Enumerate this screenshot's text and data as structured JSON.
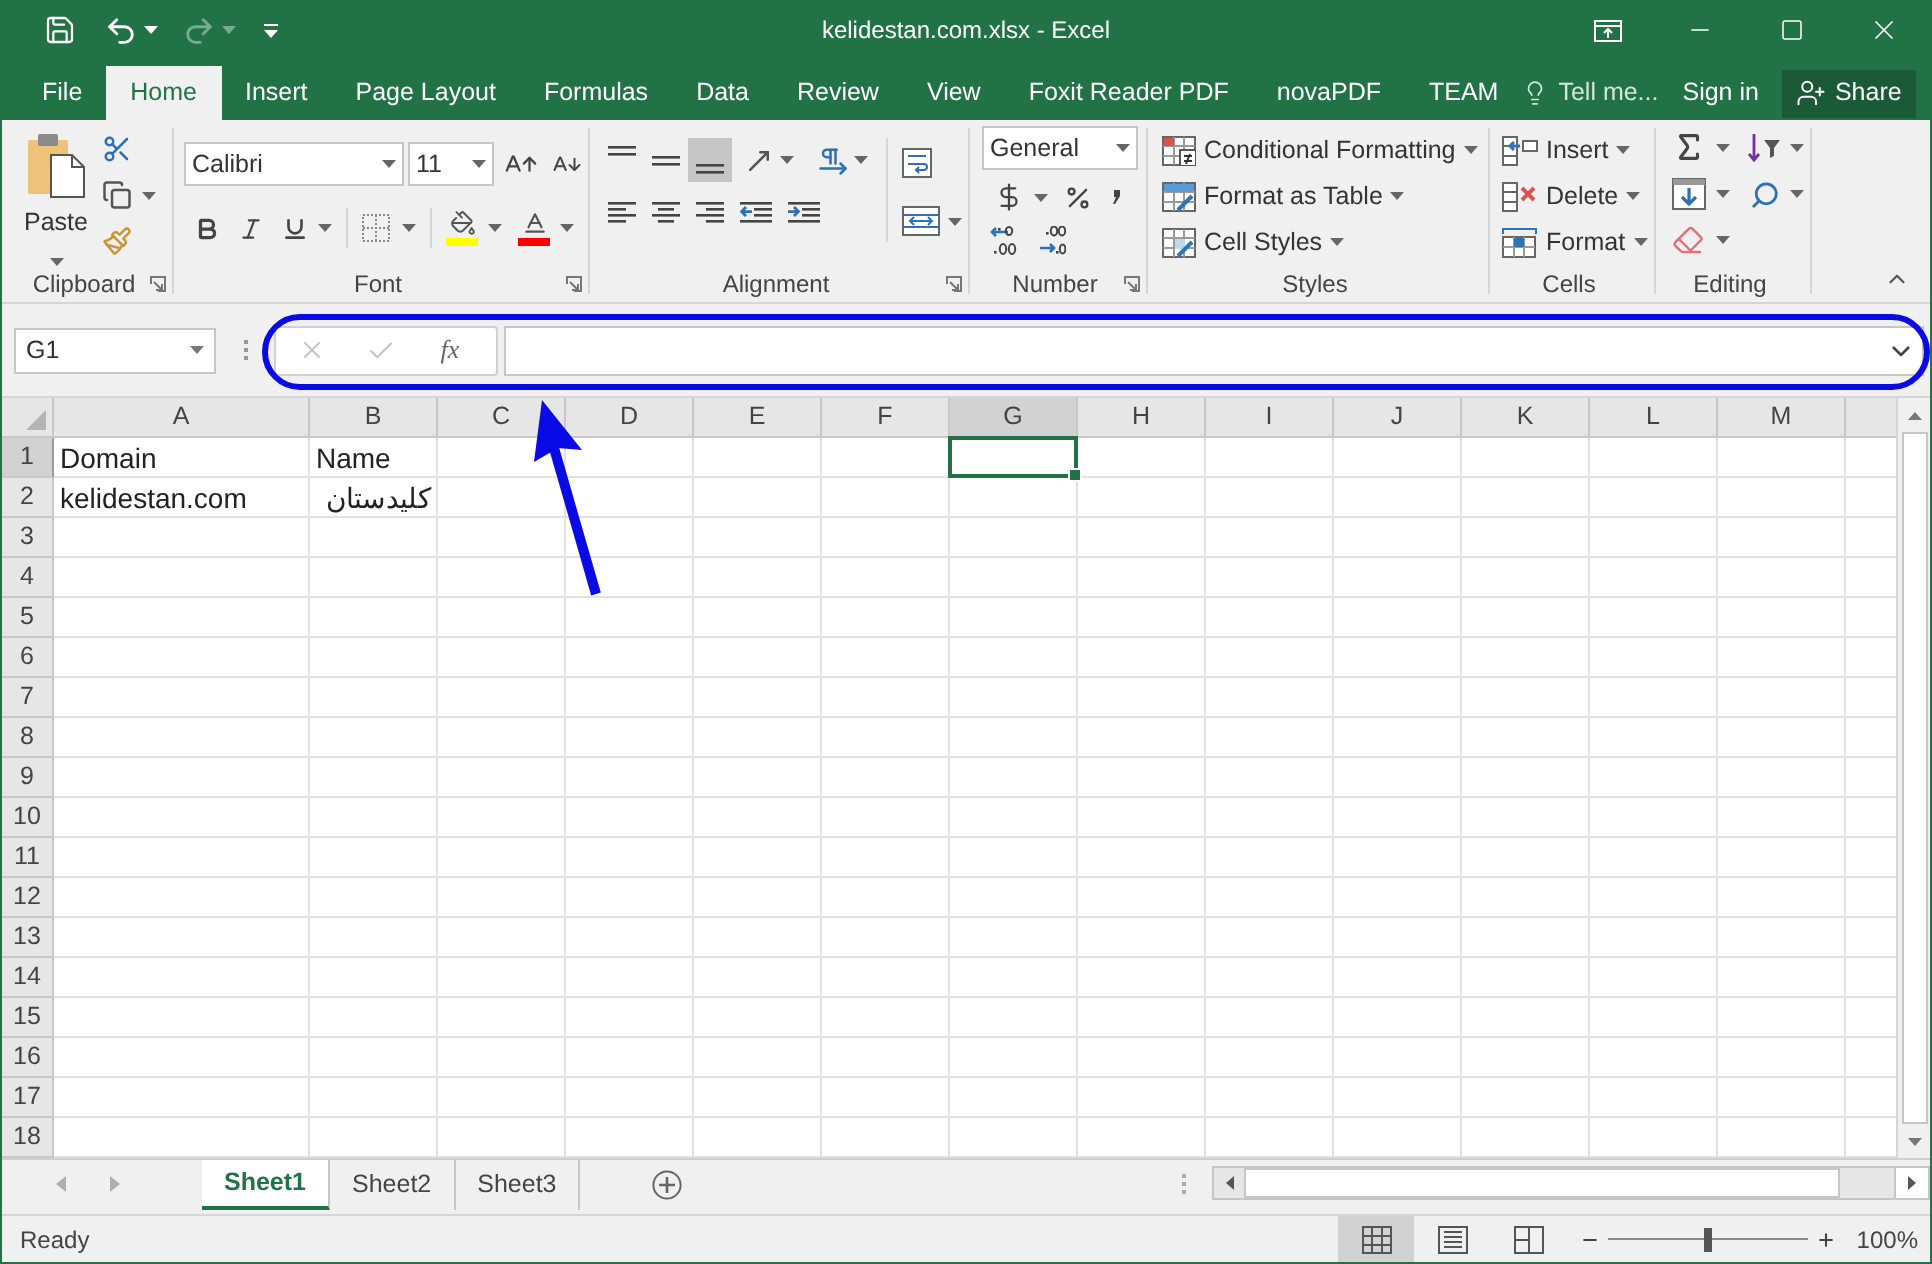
{
  "window": {
    "title": "kelidestan.com.xlsx - Excel"
  },
  "quick_access": [
    {
      "kind": "save",
      "disabled": false
    },
    {
      "kind": "undo",
      "disabled": false
    },
    {
      "kind": "redo",
      "disabled": true
    },
    {
      "kind": "customize",
      "disabled": false
    }
  ],
  "ribbon_tabs": [
    {
      "label": "File",
      "selected": false
    },
    {
      "label": "Home",
      "selected": true
    },
    {
      "label": "Insert",
      "selected": false
    },
    {
      "label": "Page Layout",
      "selected": false
    },
    {
      "label": "Formulas",
      "selected": false
    },
    {
      "label": "Data",
      "selected": false
    },
    {
      "label": "Review",
      "selected": false
    },
    {
      "label": "View",
      "selected": false
    },
    {
      "label": "Foxit Reader PDF",
      "selected": false
    },
    {
      "label": "novaPDF",
      "selected": false
    },
    {
      "label": "TEAM",
      "selected": false
    }
  ],
  "tell_me": "Tell me...",
  "account": {
    "sign_in": "Sign in",
    "share": "Share"
  },
  "ribbon": {
    "clipboard": {
      "label": "Clipboard",
      "paste": "Paste"
    },
    "font": {
      "label": "Font",
      "font_name": "Calibri",
      "font_size": "11"
    },
    "alignment": {
      "label": "Alignment",
      "vertical": [
        {
          "kind": "top",
          "selected": false
        },
        {
          "kind": "middle",
          "selected": false
        },
        {
          "kind": "bottom",
          "selected": true
        }
      ]
    },
    "number": {
      "label": "Number",
      "format": "General"
    },
    "styles": {
      "label": "Styles",
      "buttons": [
        "Conditional Formatting",
        "Format as Table",
        "Cell Styles"
      ]
    },
    "cells": {
      "label": "Cells",
      "buttons": [
        "Insert",
        "Delete",
        "Format"
      ]
    },
    "editing": {
      "label": "Editing"
    }
  },
  "formula_bar": {
    "name_box": "G1",
    "buttons": [
      {
        "kind": "cancel",
        "disabled": true
      },
      {
        "kind": "enter",
        "disabled": true
      },
      {
        "kind": "function",
        "label": "fx",
        "disabled": false
      }
    ]
  },
  "sheet": {
    "columns": [
      {
        "label": "A",
        "selected": false
      },
      {
        "label": "B",
        "selected": false
      },
      {
        "label": "C",
        "selected": false
      },
      {
        "label": "D",
        "selected": false
      },
      {
        "label": "E",
        "selected": false
      },
      {
        "label": "F",
        "selected": false
      },
      {
        "label": "G",
        "selected": true
      },
      {
        "label": "H",
        "selected": false
      },
      {
        "label": "I",
        "selected": false
      },
      {
        "label": "J",
        "selected": false
      },
      {
        "label": "K",
        "selected": false
      },
      {
        "label": "L",
        "selected": false
      },
      {
        "label": "M",
        "selected": false
      }
    ],
    "rows": [
      {
        "label": "1",
        "selected": true,
        "cells": [
          "Domain",
          "Name"
        ]
      },
      {
        "label": "2",
        "selected": false,
        "cells": [
          "kelidestan.com",
          "کلیدستان"
        ]
      },
      {
        "label": "3",
        "selected": false
      },
      {
        "label": "4",
        "selected": false
      },
      {
        "label": "5",
        "selected": false
      },
      {
        "label": "6",
        "selected": false
      },
      {
        "label": "7",
        "selected": false
      },
      {
        "label": "8",
        "selected": false
      },
      {
        "label": "9",
        "selected": false
      },
      {
        "label": "10",
        "selected": false
      },
      {
        "label": "11",
        "selected": false
      },
      {
        "label": "12",
        "selected": false
      },
      {
        "label": "13",
        "selected": false
      },
      {
        "label": "14",
        "selected": false
      },
      {
        "label": "15",
        "selected": false
      },
      {
        "label": "16",
        "selected": false
      },
      {
        "label": "17",
        "selected": false
      },
      {
        "label": "18",
        "selected": false
      }
    ]
  },
  "sheet_tabs": [
    {
      "label": "Sheet1",
      "selected": true
    },
    {
      "label": "Sheet2",
      "selected": false
    },
    {
      "label": "Sheet3",
      "selected": false
    }
  ],
  "status_bar": {
    "text": "Ready",
    "views": [
      {
        "kind": "normal",
        "selected": true
      },
      {
        "kind": "page_layout",
        "selected": false
      },
      {
        "kind": "page_break",
        "selected": false
      }
    ],
    "zoom": {
      "level": 0.5,
      "reading": "100%"
    }
  }
}
